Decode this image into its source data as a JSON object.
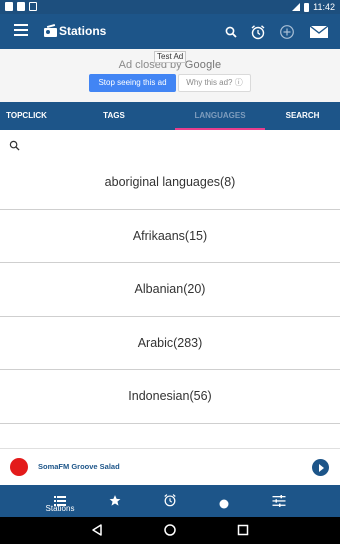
{
  "status_bar": {
    "time": "11:42"
  },
  "app_bar": {
    "title": "Stations",
    "actions": [
      "search-icon",
      "alarm-clock-icon",
      "add-circle-icon",
      "mail-icon"
    ]
  },
  "ad": {
    "test_label": "Test Ad",
    "closed_prefix": "Ad closed by",
    "brand": "Google",
    "stop_label": "Stop seeing this ad",
    "why_label": "Why this ad? ⓘ"
  },
  "tabs": [
    {
      "label": "TOPCLICK",
      "active": false
    },
    {
      "label": "TAGS",
      "active": false
    },
    {
      "label": "LANGUAGES",
      "active": true
    },
    {
      "label": "SEARCH",
      "active": false
    }
  ],
  "languages": [
    {
      "label": "aboriginal languages(8)"
    },
    {
      "label": "Afrikaans(15)"
    },
    {
      "label": "Albanian(20)"
    },
    {
      "label": "Arabic(283)"
    },
    {
      "label": "Indonesian(56)"
    }
  ],
  "now_playing": {
    "station": "SomaFM Groove Salad"
  },
  "bottom_nav": [
    {
      "icon": "list-icon",
      "label": "Stations"
    },
    {
      "icon": "star-icon",
      "label": ""
    },
    {
      "icon": "alarm-clock-icon",
      "label": ""
    },
    {
      "icon": "record-icon",
      "label": ""
    },
    {
      "icon": "equalizer-icon",
      "label": ""
    }
  ],
  "colors": {
    "primary": "#1d5589",
    "accent": "#e83e8c",
    "ad_button": "#4285f4",
    "record": "#e31b1b"
  }
}
